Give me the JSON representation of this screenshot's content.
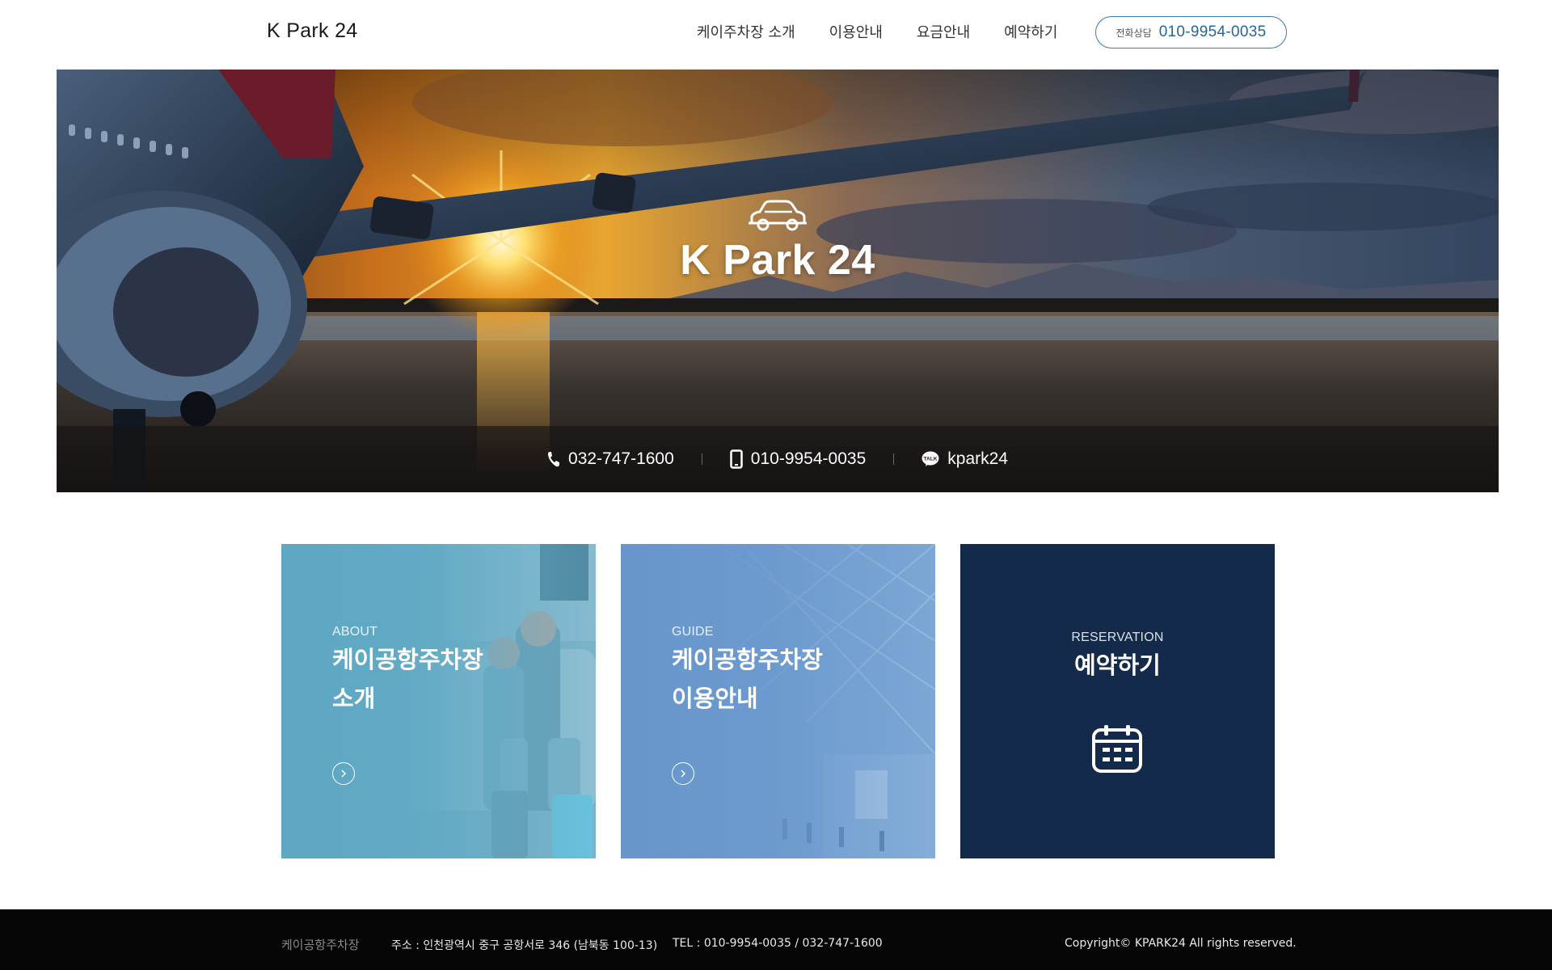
{
  "header": {
    "logo": "K Park 24",
    "nav": [
      {
        "label": "케이주차장 소개"
      },
      {
        "label": "이용안내"
      },
      {
        "label": "요금안내"
      },
      {
        "label": "예약하기"
      }
    ],
    "phone_label": "전화상담",
    "phone_number": "010-9954-0035"
  },
  "hero": {
    "title": "K Park 24",
    "contacts": [
      {
        "icon": "phone-icon",
        "text": "032-747-1600"
      },
      {
        "icon": "mobile-icon",
        "text": "010-9954-0035"
      },
      {
        "icon": "kakaotalk-icon",
        "text": "kpark24"
      }
    ]
  },
  "cards": [
    {
      "en": "ABOUT",
      "ko_line1": "케이공항주차장",
      "ko_line2": "소개",
      "color": "#5ea8c4"
    },
    {
      "en": "GUIDE",
      "ko_line1": "케이공항주차장",
      "ko_line2": "이용안내",
      "color": "#6796cc"
    },
    {
      "en": "RESERVATION",
      "ko_line1": "예약하기",
      "color": "#132a4a"
    }
  ],
  "footer": {
    "name": "케이공항주차장",
    "address": "주소 : 인천광역시 중구 공항서로 346 (남북동 100-13)",
    "tel": "TEL : 010-9954-0035 / 032-747-1600",
    "copyright": "Copyright© KPARK24 All rights reserved."
  }
}
